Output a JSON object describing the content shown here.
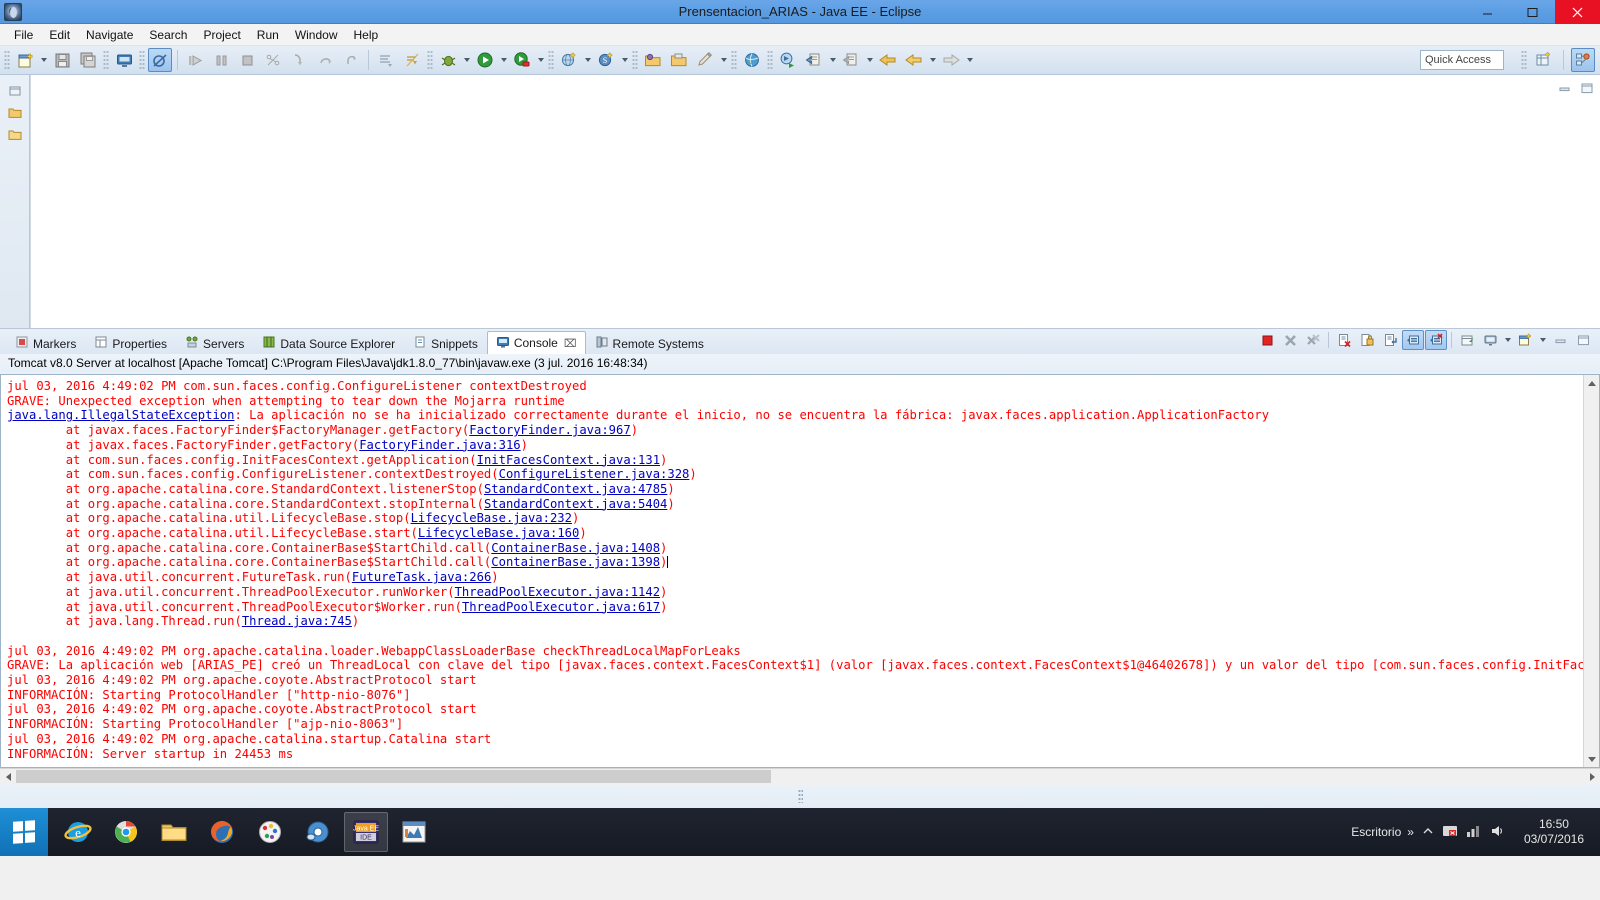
{
  "window": {
    "title": "Prensentacion_ARIAS - Java EE - Eclipse",
    "app_icon": "eclipse-icon",
    "minimize": "minimize-button",
    "maximize": "maximize-button",
    "close": "close-button"
  },
  "menubar": {
    "items": [
      {
        "label": "File"
      },
      {
        "label": "Edit"
      },
      {
        "label": "Navigate"
      },
      {
        "label": "Search"
      },
      {
        "label": "Project"
      },
      {
        "label": "Run"
      },
      {
        "label": "Window"
      },
      {
        "label": "Help"
      }
    ]
  },
  "toolbar": {
    "quick_access_placeholder": "Quick Access",
    "buttons": [
      {
        "name": "new-wizard-icon",
        "glyph": "὜B"
      },
      {
        "name": "save-icon"
      },
      {
        "name": "save-all-icon"
      },
      {
        "name": "print-icon"
      },
      {
        "name": "toggle-breakpoint-icon"
      },
      {
        "name": "resume-icon"
      },
      {
        "name": "suspend-icon"
      },
      {
        "name": "terminate-icon"
      },
      {
        "name": "disconnect-icon"
      },
      {
        "name": "step-into-icon"
      },
      {
        "name": "step-over-icon"
      },
      {
        "name": "step-return-icon"
      },
      {
        "name": "open-task-icon"
      },
      {
        "name": "skip-breakpoints-icon"
      },
      {
        "name": "debug-icon"
      },
      {
        "name": "run-icon"
      },
      {
        "name": "run-as-server-icon"
      },
      {
        "name": "new-web-project-icon"
      },
      {
        "name": "new-server-icon"
      },
      {
        "name": "open-type-icon"
      },
      {
        "name": "open-resource-icon"
      },
      {
        "name": "edit-icon"
      },
      {
        "name": "open-browser-icon"
      },
      {
        "name": "run-jsp-icon"
      },
      {
        "name": "previous-annotation-icon"
      },
      {
        "name": "next-annotation-icon"
      },
      {
        "name": "back-icon"
      },
      {
        "name": "forward-icon"
      }
    ],
    "perspective": {
      "open_perspective": "open-perspective-icon",
      "current": "java-ee-perspective-icon"
    }
  },
  "editor": {
    "empty": ""
  },
  "panel": {
    "tabs": [
      {
        "label": "Markers",
        "icon": "markers-icon",
        "active": false
      },
      {
        "label": "Properties",
        "icon": "properties-icon",
        "active": false
      },
      {
        "label": "Servers",
        "icon": "servers-icon",
        "active": false
      },
      {
        "label": "Data Source Explorer",
        "icon": "data-source-explorer-icon",
        "active": false
      },
      {
        "label": "Snippets",
        "icon": "snippets-icon",
        "active": false
      },
      {
        "label": "Console",
        "icon": "console-icon",
        "active": true
      },
      {
        "label": "Remote Systems",
        "icon": "remote-systems-icon",
        "active": false
      }
    ],
    "tab_close_glyph": "⌧",
    "tools": [
      {
        "name": "terminate-icon",
        "on": false
      },
      {
        "name": "remove-launch-icon",
        "on": false
      },
      {
        "name": "remove-all-terminated-icon",
        "on": false
      },
      {
        "name": "clear-console-icon",
        "on": false
      },
      {
        "name": "scroll-lock-icon",
        "on": false
      },
      {
        "name": "word-wrap-icon",
        "on": false
      },
      {
        "name": "pin-console-icon",
        "on": true
      },
      {
        "name": "display-selected-console-icon",
        "on": true
      },
      {
        "name": "open-console-icon",
        "on": false
      },
      {
        "name": "display-console-icon",
        "on": false
      },
      {
        "name": "new-console-view-icon",
        "on": false
      },
      {
        "name": "minimize-panel-icon",
        "on": false
      },
      {
        "name": "maximize-panel-icon",
        "on": false
      }
    ],
    "console_header": "Tomcat v8.0 Server at localhost [Apache Tomcat] C:\\Program Files\\Java\\jdk1.8.0_77\\bin\\javaw.exe (3 jul. 2016 16:48:34)"
  },
  "console": {
    "lines": [
      {
        "type": "plain",
        "text": "jul 03, 2016 4:49:02 PM com.sun.faces.config.ConfigureListener contextDestroyed"
      },
      {
        "type": "plain",
        "text": "GRAVE: Unexpected exception when attempting to tear down the Mojarra runtime"
      },
      {
        "type": "link_prefix",
        "link": "java.lang.IllegalStateException",
        "text": ": La aplicación no se ha inicializado correctamente durante el inicio, no se encuentra la fábrica: javax.faces.application.ApplicationFactory"
      },
      {
        "type": "trace",
        "pre": "        at javax.faces.FactoryFinder$FactoryManager.getFactory(",
        "link": "FactoryFinder.java:967",
        "post": ")"
      },
      {
        "type": "trace",
        "pre": "        at javax.faces.FactoryFinder.getFactory(",
        "link": "FactoryFinder.java:316",
        "post": ")"
      },
      {
        "type": "trace",
        "pre": "        at com.sun.faces.config.InitFacesContext.getApplication(",
        "link": "InitFacesContext.java:131",
        "post": ")"
      },
      {
        "type": "trace",
        "pre": "        at com.sun.faces.config.ConfigureListener.contextDestroyed(",
        "link": "ConfigureListener.java:328",
        "post": ")"
      },
      {
        "type": "trace",
        "pre": "        at org.apache.catalina.core.StandardContext.listenerStop(",
        "link": "StandardContext.java:4785",
        "post": ")"
      },
      {
        "type": "trace",
        "pre": "        at org.apache.catalina.core.StandardContext.stopInternal(",
        "link": "StandardContext.java:5404",
        "post": ")"
      },
      {
        "type": "trace",
        "pre": "        at org.apache.catalina.util.LifecycleBase.stop(",
        "link": "LifecycleBase.java:232",
        "post": ")"
      },
      {
        "type": "trace",
        "pre": "        at org.apache.catalina.util.LifecycleBase.start(",
        "link": "LifecycleBase.java:160",
        "post": ")"
      },
      {
        "type": "trace",
        "pre": "        at org.apache.catalina.core.ContainerBase$StartChild.call(",
        "link": "ContainerBase.java:1408",
        "post": ")"
      },
      {
        "type": "trace_caret",
        "pre": "        at org.apache.catalina.core.ContainerBase$StartChild.call(",
        "link": "ContainerBase.java:1398",
        "post": ")"
      },
      {
        "type": "trace",
        "pre": "        at java.util.concurrent.FutureTask.run(",
        "link": "FutureTask.java:266",
        "post": ")"
      },
      {
        "type": "trace",
        "pre": "        at java.util.concurrent.ThreadPoolExecutor.runWorker(",
        "link": "ThreadPoolExecutor.java:1142",
        "post": ")"
      },
      {
        "type": "trace",
        "pre": "        at java.util.concurrent.ThreadPoolExecutor$Worker.run(",
        "link": "ThreadPoolExecutor.java:617",
        "post": ")"
      },
      {
        "type": "trace",
        "pre": "        at java.lang.Thread.run(",
        "link": "Thread.java:745",
        "post": ")"
      },
      {
        "type": "blank",
        "text": ""
      },
      {
        "type": "plain",
        "text": "jul 03, 2016 4:49:02 PM org.apache.catalina.loader.WebappClassLoaderBase checkThreadLocalMapForLeaks"
      },
      {
        "type": "plain",
        "text": "GRAVE: La aplicación web [ARIAS_PE] creó un ThreadLocal con clave del tipo [javax.faces.context.FacesContext$1] (valor [javax.faces.context.FacesContext$1@46402678]) y un valor del tipo [com.sun.faces.config.InitFacesCon"
      },
      {
        "type": "plain",
        "text": "jul 03, 2016 4:49:02 PM org.apache.coyote.AbstractProtocol start"
      },
      {
        "type": "plain",
        "text": "INFORMACIÓN: Starting ProtocolHandler [\"http-nio-8076\"]"
      },
      {
        "type": "plain",
        "text": "jul 03, 2016 4:49:02 PM org.apache.coyote.AbstractProtocol start"
      },
      {
        "type": "plain",
        "text": "INFORMACIÓN: Starting ProtocolHandler [\"ajp-nio-8063\"]"
      },
      {
        "type": "plain",
        "text": "jul 03, 2016 4:49:02 PM org.apache.catalina.startup.Catalina start"
      },
      {
        "type": "plain",
        "text": "INFORMACIÓN: Server startup in 24453 ms"
      }
    ],
    "text_color": "#ff0000",
    "link_color": "#0000c0"
  },
  "taskbar": {
    "start": "windows-start-button",
    "items": [
      {
        "name": "internet-explorer-icon"
      },
      {
        "name": "google-chrome-icon"
      },
      {
        "name": "file-explorer-icon"
      },
      {
        "name": "firefox-icon"
      },
      {
        "name": "paint-icon"
      },
      {
        "name": "media-player-icon"
      },
      {
        "name": "eclipse-taskbar-icon",
        "running": true
      },
      {
        "name": "netbeans-taskbar-icon"
      }
    ],
    "tray": {
      "desktop_label": "Escritorio",
      "expand_glyph": "»",
      "show_hidden_icons": "show-hidden-icons-icon",
      "icons": [
        {
          "name": "antivirus-tray-icon"
        },
        {
          "name": "network-tray-icon"
        },
        {
          "name": "volume-tray-icon"
        }
      ],
      "time": "16:50",
      "date": "03/07/2016"
    }
  }
}
